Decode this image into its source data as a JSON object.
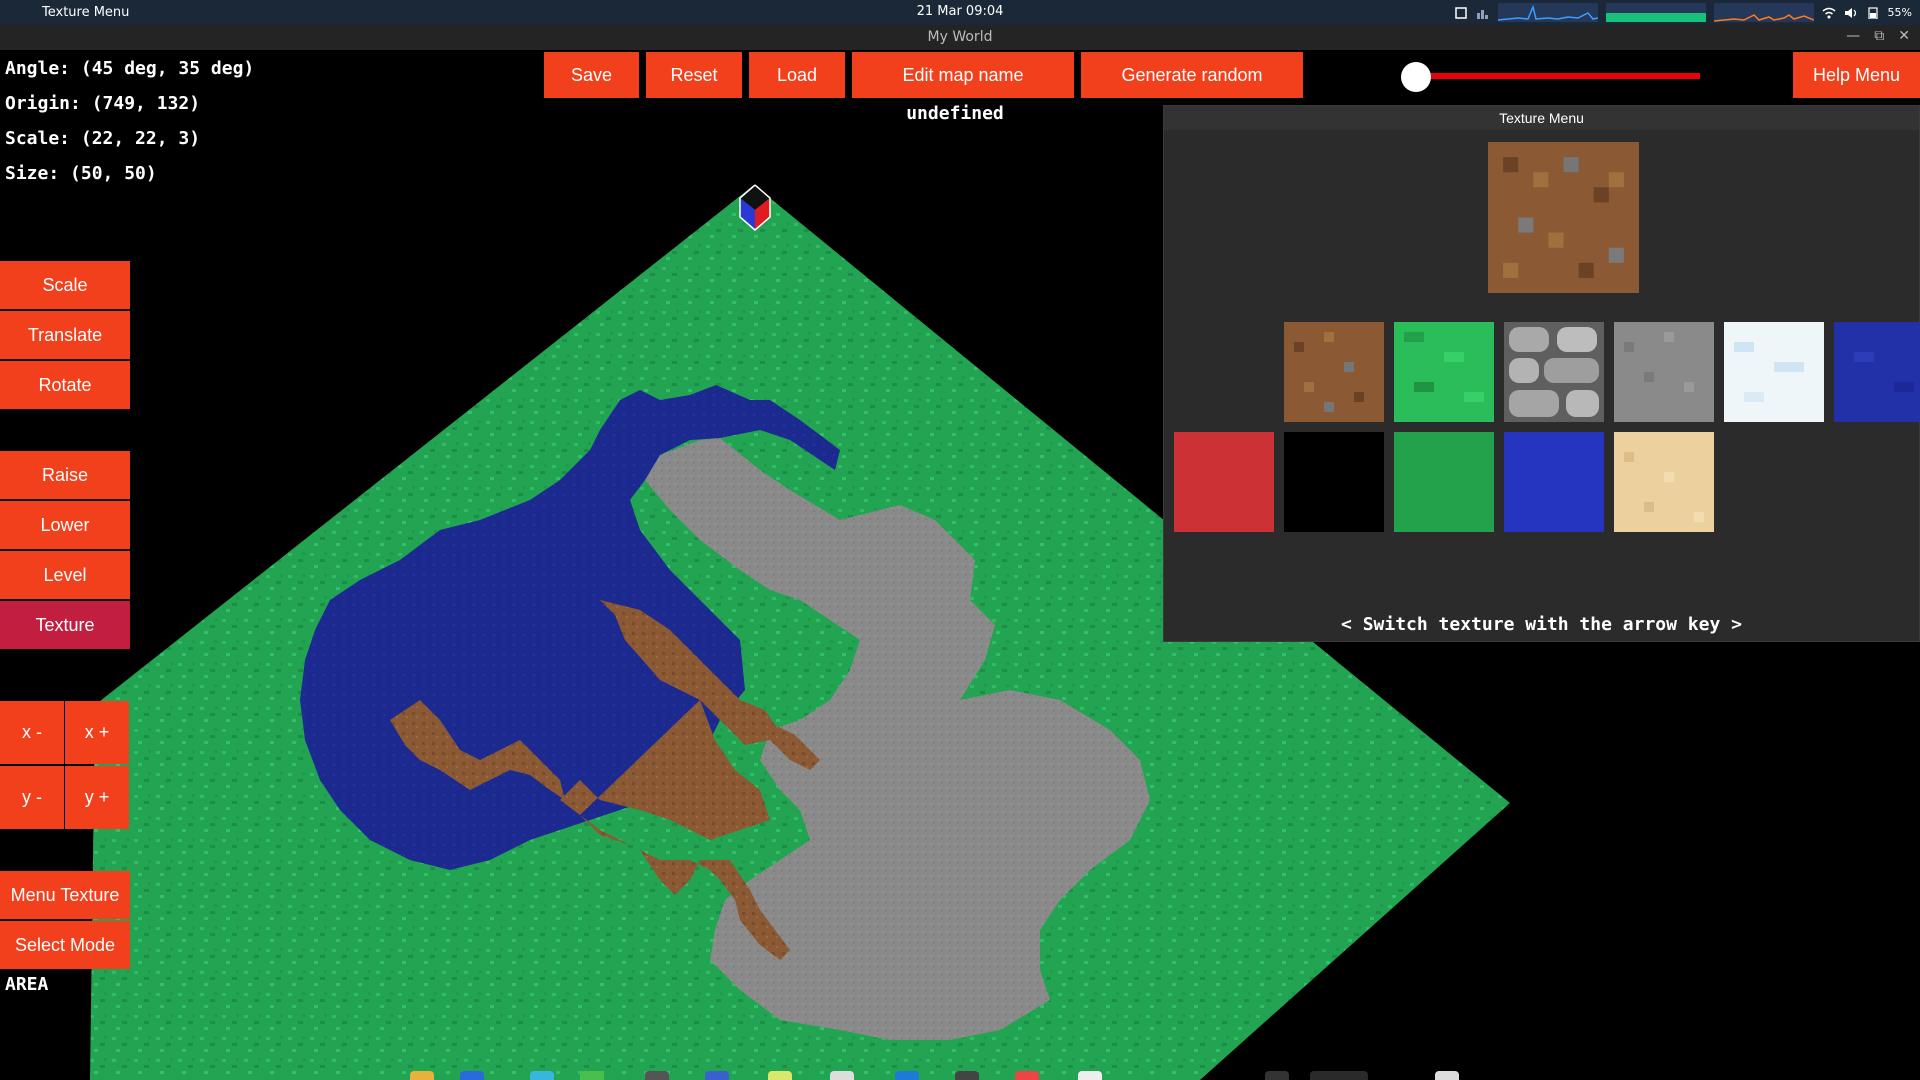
{
  "system_bar": {
    "app_name": "Texture Menu",
    "clock": "21 Mar  09:04",
    "battery": "55%"
  },
  "window": {
    "title": "My World"
  },
  "info": {
    "angle": "Angle: (45 deg, 35 deg)",
    "origin": "Origin: (749, 132)",
    "scale": "Scale: (22, 22, 3)",
    "size": "Size: (50, 50)",
    "mode": "AREA"
  },
  "toolbar": {
    "save": "Save",
    "reset": "Reset",
    "load": "Load",
    "edit_map_name": "Edit map name",
    "generate_random": "Generate random",
    "help_menu": "Help Menu"
  },
  "map_name": "undefined",
  "side_buttons": {
    "scale": "Scale",
    "translate": "Translate",
    "rotate": "Rotate",
    "raise": "Raise",
    "lower": "Lower",
    "level": "Level",
    "texture": "Texture",
    "x_minus": "x -",
    "x_plus": "x +",
    "y_minus": "y -",
    "y_plus": "y +",
    "menu_texture": "Menu Texture",
    "select_mode": "Select Mode"
  },
  "texture_menu": {
    "title": "Texture Menu",
    "footer": "< Switch texture with the arrow key >",
    "selected": "dirt",
    "textures": [
      "empty",
      "dirt",
      "grass",
      "cobblestone",
      "stone",
      "snow",
      "water",
      "red",
      "black",
      "green",
      "blue",
      "sand"
    ]
  },
  "slider": {
    "value": 0
  },
  "colors": {
    "button": "#f2401c",
    "button_selected": "#c21e3f",
    "grass": "#23a855",
    "water": "#1c2a8e",
    "stone": "#8b8b8b",
    "dirt": "#8c5a36"
  }
}
